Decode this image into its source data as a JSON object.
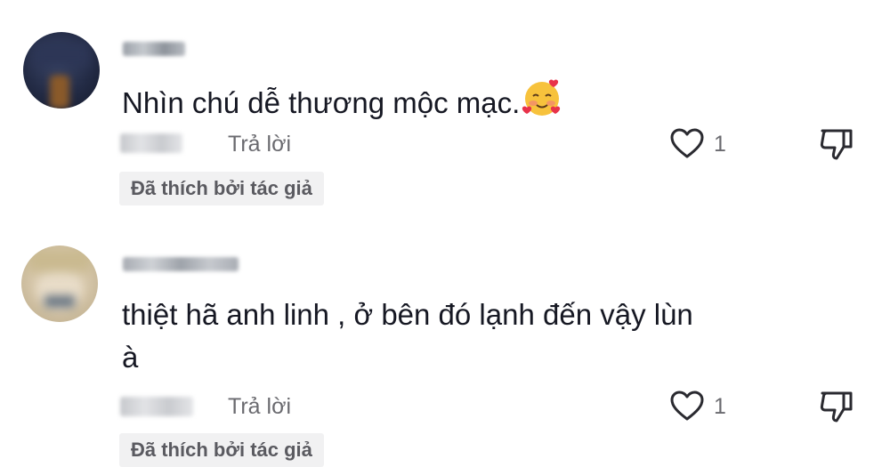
{
  "comments": [
    {
      "text": "Nhìn chú dễ thương mộc mạc.",
      "emoji": "smiling-face-with-hearts",
      "reply_label": "Trả lời",
      "like_count": "1",
      "liked_by_author": "Đã thích bởi tác giả"
    },
    {
      "text": "thiệt hã anh linh , ở bên đó lạnh đến vậy lùn\nà",
      "reply_label": "Trả lời",
      "like_count": "1",
      "liked_by_author": "Đã thích bởi tác giả"
    }
  ],
  "icons": {
    "like": "heart-outline-icon",
    "dislike": "thumbs-down-icon"
  },
  "colors": {
    "text": "#161823",
    "muted": "#6a6a6f",
    "badge_bg": "#f1f1f2"
  }
}
